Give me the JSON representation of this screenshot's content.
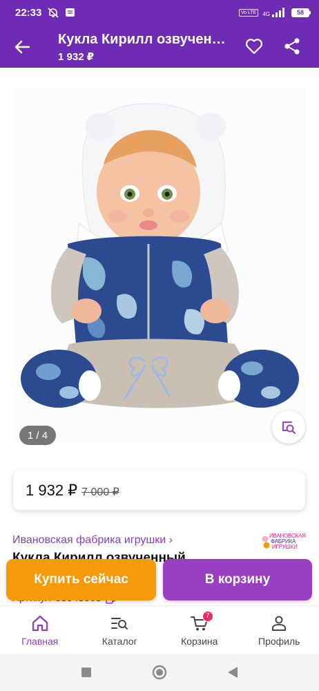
{
  "status_bar": {
    "time": "22:33",
    "volte": "Vo LTE",
    "network": "4G",
    "battery": "58"
  },
  "header": {
    "title": "Кукла Кирилл озвученный",
    "price": "1 932 ₽"
  },
  "gallery": {
    "counter": "1 / 4"
  },
  "price_card": {
    "current": "1 932 ₽",
    "old": "7 000 ₽"
  },
  "product": {
    "brand": "Ивановская фабрика игрушки ›",
    "brand_logo": [
      "ИВАНОВСКАЯ",
      "ФАБРИКА",
      "ИГРУШКИ"
    ],
    "name": "Кукла Кирилл озвученный",
    "article_label": "Артикул",
    "article_number": "38048068"
  },
  "actions": {
    "buy_now": "Купить сейчас",
    "add_to_cart": "В корзину"
  },
  "bottom_nav": {
    "items": [
      {
        "label": "Главная",
        "icon": "home-icon",
        "active": true
      },
      {
        "label": "Каталог",
        "icon": "catalog-search-icon",
        "active": false
      },
      {
        "label": "Корзина",
        "icon": "cart-icon",
        "active": false,
        "badge": "7"
      },
      {
        "label": "Профиль",
        "icon": "profile-icon",
        "active": false
      }
    ]
  },
  "colors": {
    "brand_purple": "#6e2bb3",
    "accent_purple": "#9b3fc2",
    "buy_orange": "#f59a0b",
    "badge_pink": "#ee2a5b"
  }
}
